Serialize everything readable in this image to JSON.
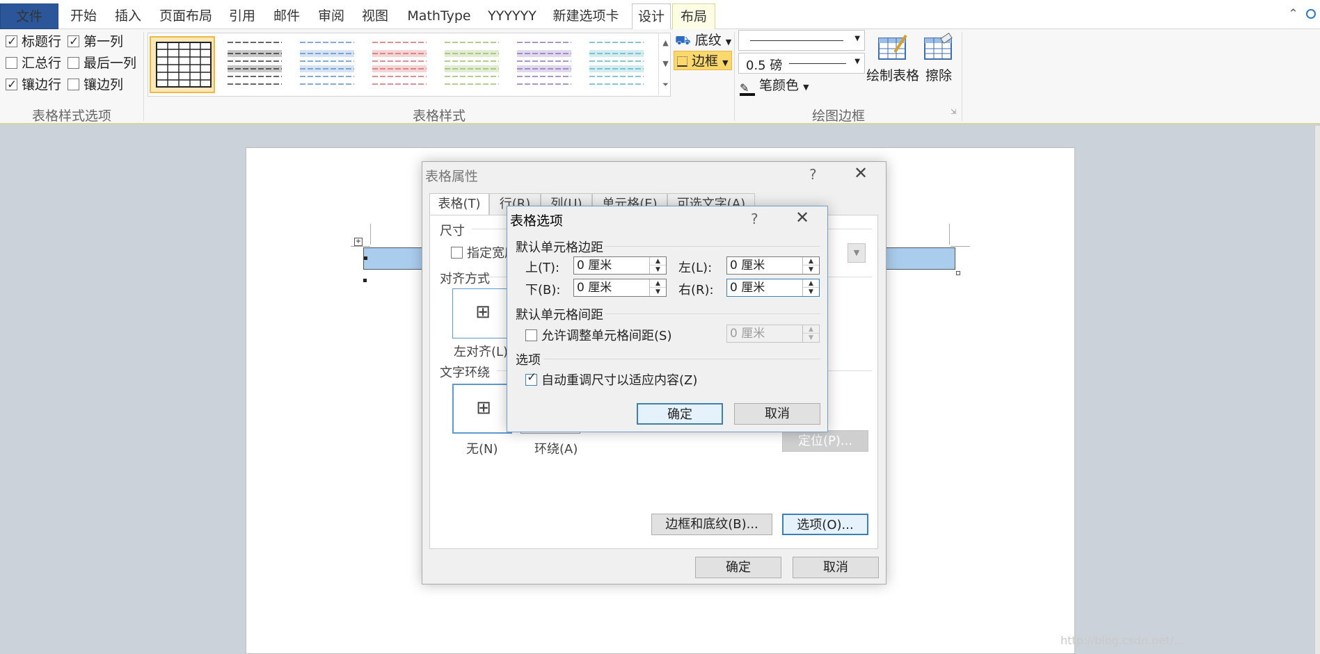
{
  "tabs": {
    "file": "文件",
    "home": "开始",
    "insert": "插入",
    "layout": "页面布局",
    "references": "引用",
    "mailings": "邮件",
    "review": "审阅",
    "view": "视图",
    "mathtype": "MathType",
    "yyyyyy": "YYYYYY",
    "newtab": "新建选项卡",
    "design": "设计",
    "table_layout": "布局"
  },
  "ribbon": {
    "style_options": {
      "header_row": "标题行",
      "first_column": "第一列",
      "total_row": "汇总行",
      "last_column": "最后一列",
      "banded_rows": "镶边行",
      "banded_columns": "镶边列",
      "group_label": "表格样式选项"
    },
    "table_styles": {
      "group_label": "表格样式"
    },
    "shading_label": "底纹",
    "borders_label": "边框",
    "pen_weight": "0.5 磅",
    "pen_color_label": "笔颜色",
    "draw_table_label": "绘制表格",
    "eraser_label": "擦除",
    "draw_borders_group_label": "绘图边框"
  },
  "props_dialog": {
    "title": "表格属性",
    "help": "?",
    "tabs": [
      "表格(T)",
      "行(R)",
      "列(U)",
      "单元格(E)",
      "可选文字(A)"
    ],
    "size_label": "尺寸",
    "preferred_width": "指定宽度",
    "alignment_label": "对齐方式",
    "align_left": "左对齐(L)",
    "wrap_label": "文字环绕",
    "wrap_none": "无(N)",
    "wrap_around": "环绕(A)",
    "positioning_button": "定位(P)...",
    "borders_shading_button": "边框和底纹(B)...",
    "options_button": "选项(O)...",
    "ok": "确定",
    "cancel": "取消"
  },
  "options_dialog": {
    "title": "表格选项",
    "help": "?",
    "margins_section": "默认单元格边距",
    "top_label": "上(T):",
    "top_value": "0 厘米",
    "bottom_label": "下(B):",
    "bottom_value": "0 厘米",
    "left_label": "左(L):",
    "left_value": "0 厘米",
    "right_label": "右(R):",
    "right_value": "0 厘米",
    "spacing_section": "默认单元格间距",
    "allow_spacing": "允许调整单元格间距(S)",
    "spacing_value": "0 厘米",
    "options_section": "选项",
    "auto_resize": "自动重调尺寸以适应内容(Z)",
    "ok": "确定",
    "cancel": "取消"
  },
  "watermark": "http://blog.csdn.net/...",
  "colors": {
    "file_tab": "#2b579a",
    "selected_style": "#fbe8b8",
    "table_fill": "#aacded",
    "dialog_accent": "#3c7fb1"
  }
}
